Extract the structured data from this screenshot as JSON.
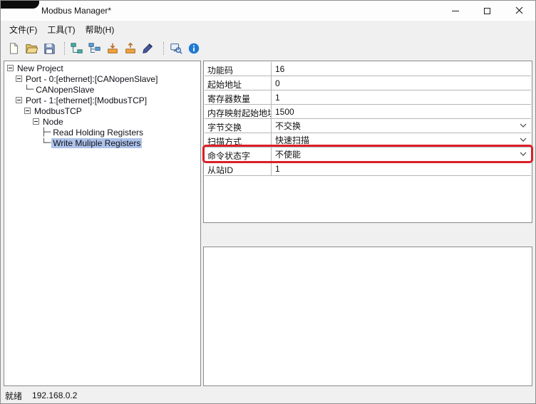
{
  "window": {
    "title": "Modbus Manager*"
  },
  "menu": {
    "items": [
      "文件(F)",
      "工具(T)",
      "帮助(H)"
    ]
  },
  "toolbar": {
    "groups": [
      {
        "icons": [
          "new-file-icon",
          "open-folder-icon",
          "save-icon"
        ]
      },
      {
        "icons": [
          "add-node-icon",
          "node-list-icon",
          "import-config-icon",
          "export-config-icon",
          "edit-pen-icon"
        ]
      },
      {
        "icons": [
          "monitor-search-icon",
          "info-icon"
        ]
      }
    ]
  },
  "tree": {
    "items": [
      {
        "indent": 0,
        "expander": true,
        "connector": "",
        "label": "New Project",
        "selected": false
      },
      {
        "indent": 1,
        "expander": true,
        "connector": "",
        "label": "Port - 0:[ethernet]:[CANopenSlave]",
        "selected": false
      },
      {
        "indent": 2,
        "expander": false,
        "connector": "└─",
        "label": "CANopenSlave",
        "selected": false
      },
      {
        "indent": 1,
        "expander": true,
        "connector": "",
        "label": "Port - 1:[ethernet]:[ModbusTCP]",
        "selected": false
      },
      {
        "indent": 2,
        "expander": true,
        "connector": "",
        "label": "ModbusTCP",
        "selected": false
      },
      {
        "indent": 3,
        "expander": true,
        "connector": "",
        "label": "Node",
        "selected": false
      },
      {
        "indent": 4,
        "expander": false,
        "connector": "├─",
        "label": "Read Holding Registers",
        "selected": false
      },
      {
        "indent": 4,
        "expander": false,
        "connector": "└─",
        "label": "Write Muliple Registers",
        "selected": true
      }
    ]
  },
  "properties": {
    "rows": [
      {
        "label": "功能码",
        "value": "16",
        "type": "text",
        "highlighted": false
      },
      {
        "label": "起始地址",
        "value": "0",
        "type": "text",
        "highlighted": false
      },
      {
        "label": "寄存器数量",
        "value": "1",
        "type": "text",
        "highlighted": false
      },
      {
        "label": "内存映射起始地址",
        "value": "1500",
        "type": "text",
        "highlighted": false
      },
      {
        "label": "字节交换",
        "value": "不交换",
        "type": "dropdown",
        "highlighted": false
      },
      {
        "label": "扫描方式",
        "value": "快速扫描",
        "type": "dropdown",
        "highlighted": false
      },
      {
        "label": "命令状态字",
        "value": "不使能",
        "type": "dropdown",
        "highlighted": true
      },
      {
        "label": "从站ID",
        "value": "1",
        "type": "text",
        "highlighted": false
      }
    ]
  },
  "status": {
    "ready": "就绪",
    "ip": "192.168.0.2"
  },
  "colors": {
    "annotation_red": "#dc1f26",
    "tree_selection": "#aec3ea"
  }
}
